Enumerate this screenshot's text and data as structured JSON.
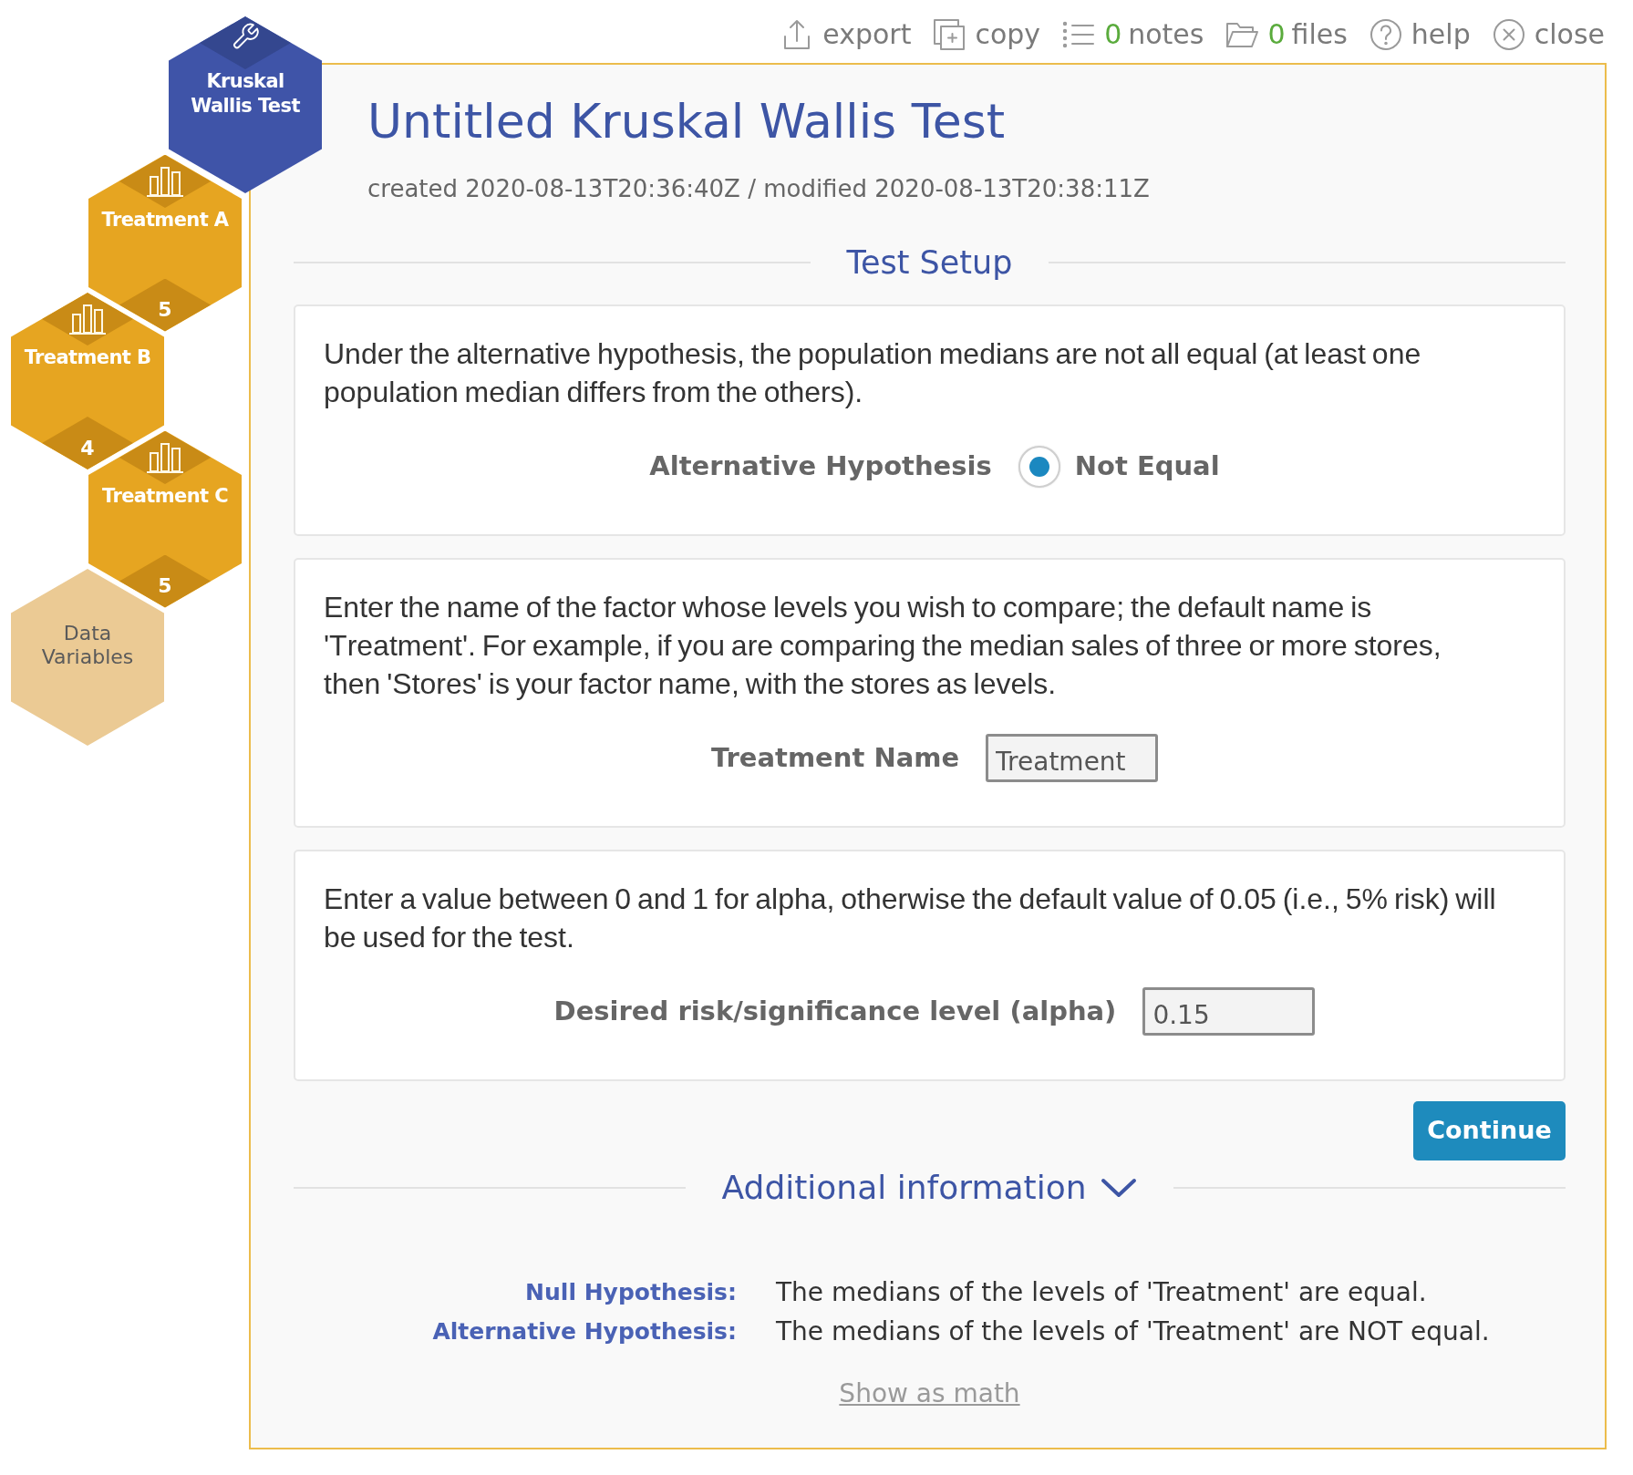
{
  "toolbar": [
    {
      "kind": "export",
      "label": "export"
    },
    {
      "kind": "copy",
      "label": "copy"
    },
    {
      "kind": "notes",
      "count": "0",
      "label": "notes"
    },
    {
      "kind": "files",
      "count": "0",
      "label": "files"
    },
    {
      "kind": "help",
      "label": "help"
    },
    {
      "kind": "close",
      "label": "close"
    }
  ],
  "steps": [
    {
      "kind": "test",
      "label": "Kruskal Wallis Test"
    },
    {
      "kind": "variable",
      "label": "Treatment A",
      "count": "5"
    },
    {
      "kind": "variable",
      "label": "Treatment B",
      "count": "4"
    },
    {
      "kind": "variable",
      "label": "Treatment C",
      "count": "5"
    },
    {
      "kind": "data",
      "label": "Data Variables"
    }
  ],
  "header": {
    "title": "Untitled Kruskal Wallis Test",
    "timestamps": "created 2020-08-13T20:36:40Z / modified 2020-08-13T20:38:11Z"
  },
  "setup": {
    "heading": "Test Setup",
    "cards": [
      {
        "kind": "radio",
        "description": "Under the alternative hypothesis, the population medians are not all equal (at least one population median differs from the others).",
        "label": "Alternative Hypothesis",
        "options": [
          {
            "label": "Not Equal",
            "selected": true
          }
        ]
      },
      {
        "kind": "input",
        "description": "Enter the name of the factor whose levels you wish to compare; the default name is 'Treatment'. For example, if you are comparing the median sales of three or more stores, then 'Stores' is your factor name, with the stores as levels.",
        "label": "Treatment Name",
        "value": "Treatment"
      },
      {
        "kind": "input",
        "description": "Enter a value between 0 and 1 for alpha, otherwise the default value of 0.05 (i.e., 5% risk) will be used for the test.",
        "label": "Desired risk/significance level (alpha)",
        "value": "0.15"
      }
    ]
  },
  "continue_button": "Continue",
  "additional_information": {
    "heading": "Additional information",
    "expanded": true,
    "rows": [
      {
        "label": "Null Hypothesis:",
        "value": "The medians of the levels of 'Treatment' are equal."
      },
      {
        "label": "Alternative Hypothesis:",
        "value": "The medians of the levels of 'Treatment' are NOT equal."
      }
    ],
    "link": "Show as math"
  }
}
